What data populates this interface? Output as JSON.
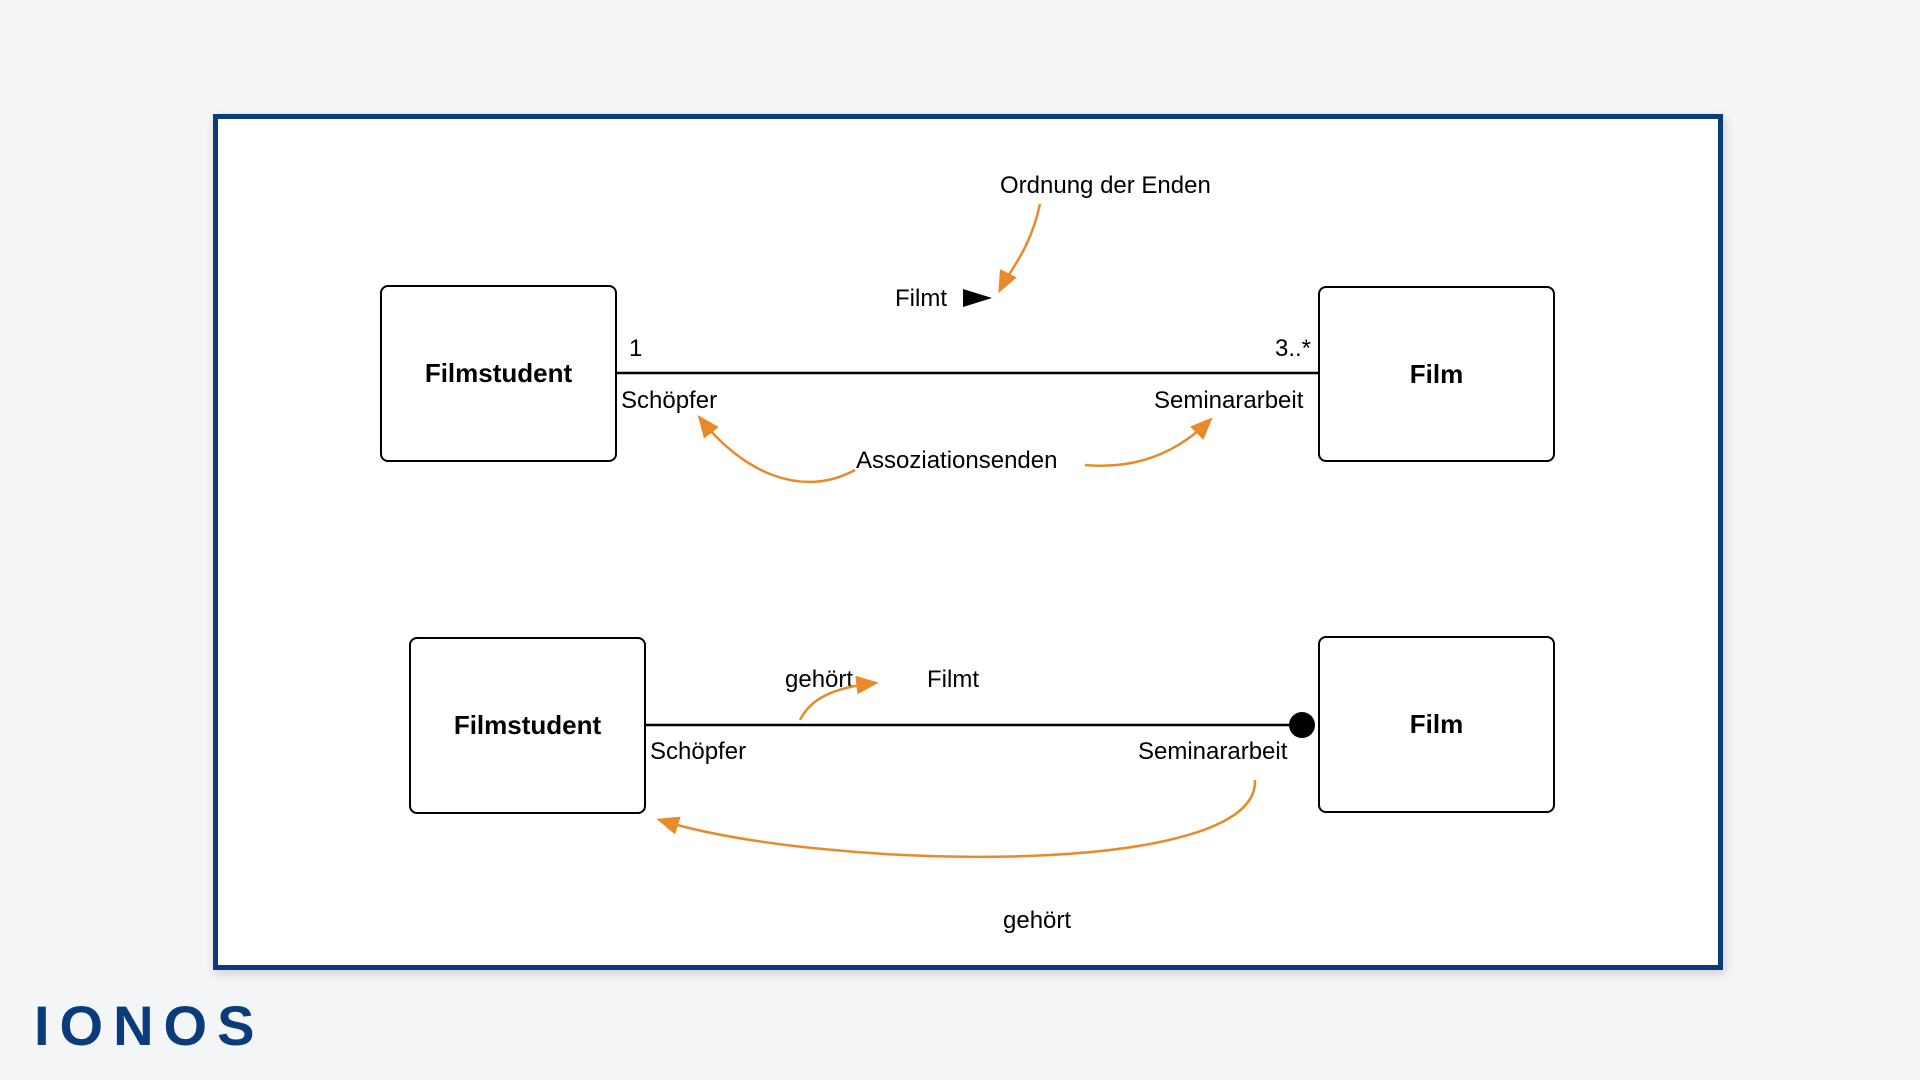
{
  "brand": "IONOS",
  "diagram1": {
    "left_class": "Filmstudent",
    "right_class": "Film",
    "left_mult": "1",
    "right_mult": "3..*",
    "left_role": "Schöpfer",
    "right_role": "Seminararbeit",
    "assoc_label": "Filmt",
    "annotation_top": "Ordnung der Enden",
    "annotation_mid": "Assoziationsenden"
  },
  "diagram2": {
    "left_class": "Filmstudent",
    "right_class": "Film",
    "left_role": "Schöpfer",
    "right_role": "Seminararbeit",
    "assoc_label_right": "Filmt",
    "assoc_label_left": "gehört",
    "annotation_bottom": "gehört"
  },
  "colors": {
    "frame_border": "#0a3b7a",
    "arrow": "#e88a2a",
    "box_border": "#000000",
    "background": "#f4f5f7"
  }
}
